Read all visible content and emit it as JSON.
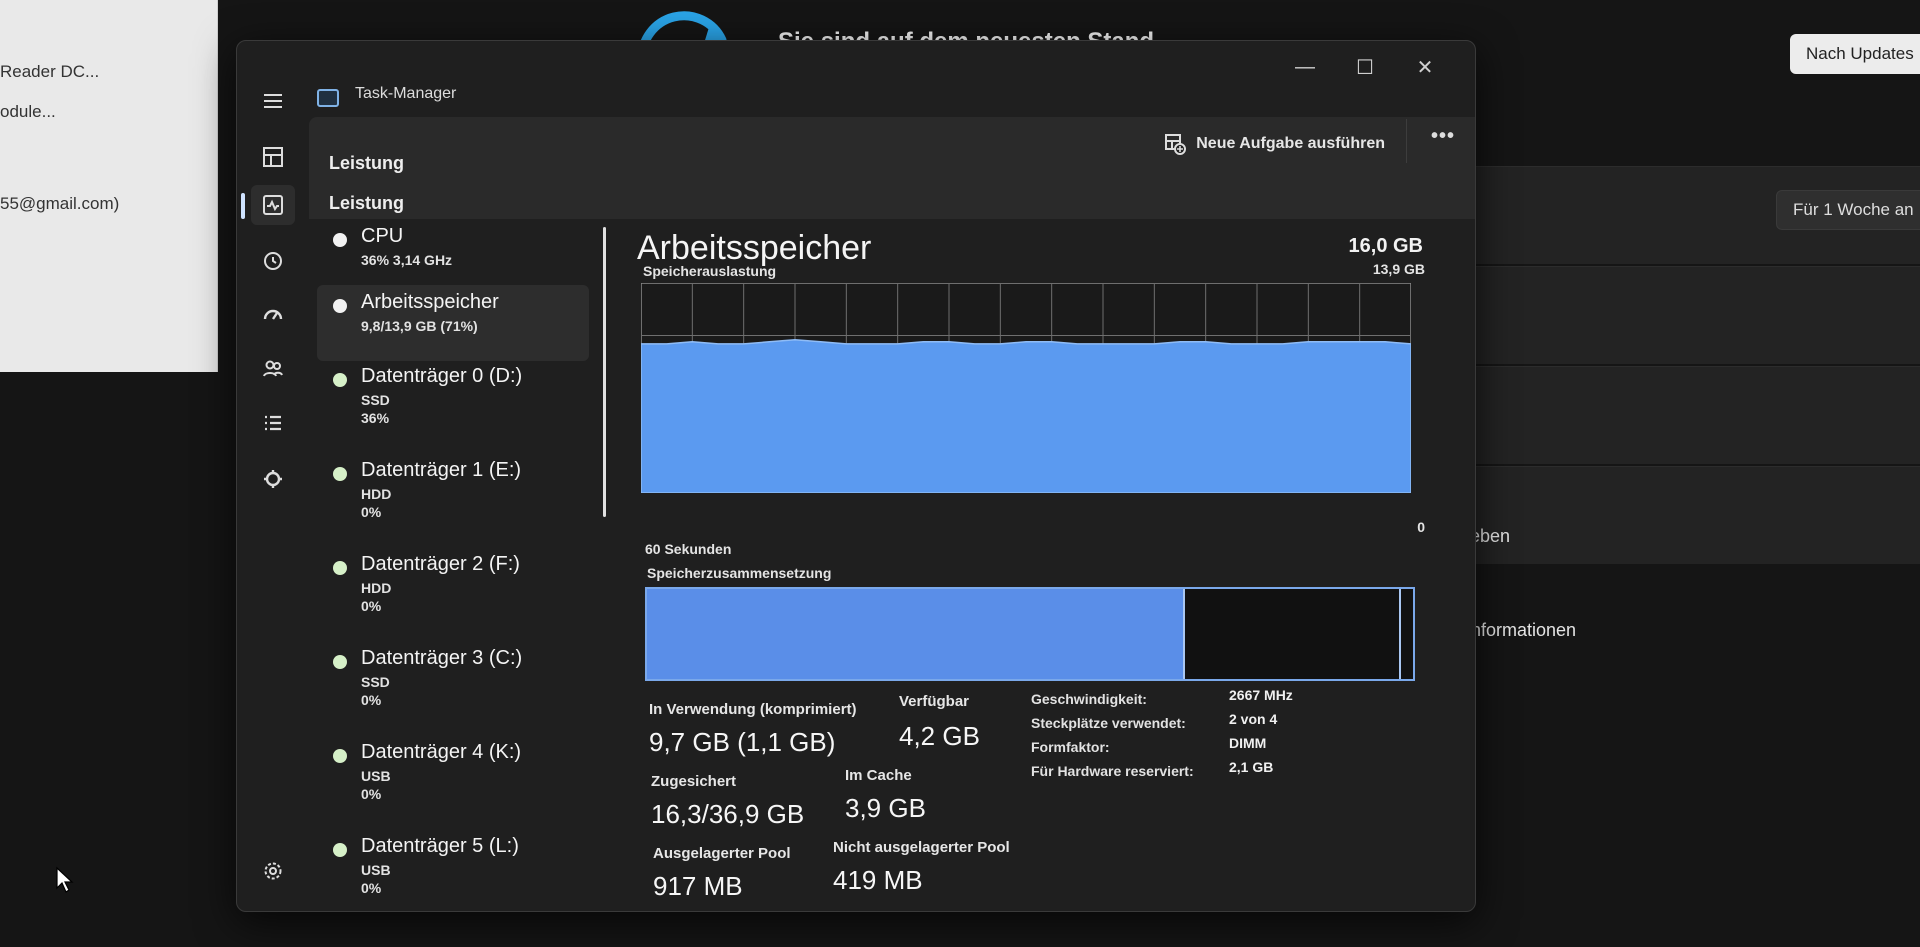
{
  "background": {
    "left_panel_lines": [
      "Reader DC...",
      "odule...",
      "55@gmail.com)"
    ],
    "update_status": "Sie sind auf dem neuesten Stand",
    "check_updates_button": "Nach Updates",
    "pause_button": "Für 1 Woche an",
    "row_text_1": "geben",
    "row_text_2": "Informationen"
  },
  "window": {
    "title": "Task-Manager",
    "minimize": "—",
    "maximize": "☐",
    "close": "✕"
  },
  "header": {
    "section_title": "Leistung",
    "new_task_label": "Neue Aufgabe ausführen",
    "more": "•••"
  },
  "devices": [
    {
      "name": "CPU",
      "sub1": "36% 3,14 GHz",
      "sub2": ""
    },
    {
      "name": "Arbeitsspeicher",
      "sub1": "9,8/13,9 GB (71%)",
      "sub2": ""
    },
    {
      "name": "Datenträger 0 (D:)",
      "sub1": "SSD",
      "sub2": "36%"
    },
    {
      "name": "Datenträger 1 (E:)",
      "sub1": "HDD",
      "sub2": "0%"
    },
    {
      "name": "Datenträger 2 (F:)",
      "sub1": "HDD",
      "sub2": "0%"
    },
    {
      "name": "Datenträger 3 (C:)",
      "sub1": "SSD",
      "sub2": "0%"
    },
    {
      "name": "Datenträger 4 (K:)",
      "sub1": "USB",
      "sub2": "0%"
    },
    {
      "name": "Datenträger 5 (L:)",
      "sub1": "USB",
      "sub2": "0%"
    }
  ],
  "memory": {
    "title": "Arbeitsspeicher",
    "total": "16,0 GB",
    "chart_max": "13,9 GB",
    "usage_label": "Speicherauslastung",
    "time_label": "60 Sekunden",
    "chart_min": "0",
    "composition_label": "Speicherzusammensetzung",
    "usage_history_fraction": [
      0.71,
      0.71,
      0.72,
      0.71,
      0.71,
      0.72,
      0.73,
      0.72,
      0.71,
      0.71,
      0.71,
      0.72,
      0.72,
      0.71,
      0.71,
      0.72,
      0.72,
      0.71,
      0.71,
      0.71,
      0.71,
      0.72,
      0.72,
      0.71,
      0.71,
      0.71,
      0.72,
      0.72,
      0.72,
      0.72,
      0.71
    ],
    "composition_in_use_fraction": 0.7,
    "composition_marker_fraction": 0.982
  },
  "stats": {
    "in_use_label": "In Verwendung (komprimiert)",
    "in_use_value": "9,7 GB (1,1 GB)",
    "available_label": "Verfügbar",
    "available_value": "4,2 GB",
    "committed_label": "Zugesichert",
    "committed_value": "16,3/36,9 GB",
    "cached_label": "Im Cache",
    "cached_value": "3,9 GB",
    "paged_label": "Ausgelagerter Pool",
    "paged_value": "917 MB",
    "nonpaged_label": "Nicht ausgelagerter Pool",
    "nonpaged_value": "419 MB"
  },
  "properties": [
    {
      "label": "Geschwindigkeit:",
      "value": "2667 MHz"
    },
    {
      "label": "Steckplätze verwendet:",
      "value": "2 von 4"
    },
    {
      "label": "Formfaktor:",
      "value": "DIMM"
    },
    {
      "label": "Für Hardware reserviert:",
      "value": "2,1 GB"
    }
  ],
  "colors": {
    "chart_fill": "#5b9af0",
    "chart_grid": "#6f6f6f",
    "accent": "#2aa4e8"
  }
}
